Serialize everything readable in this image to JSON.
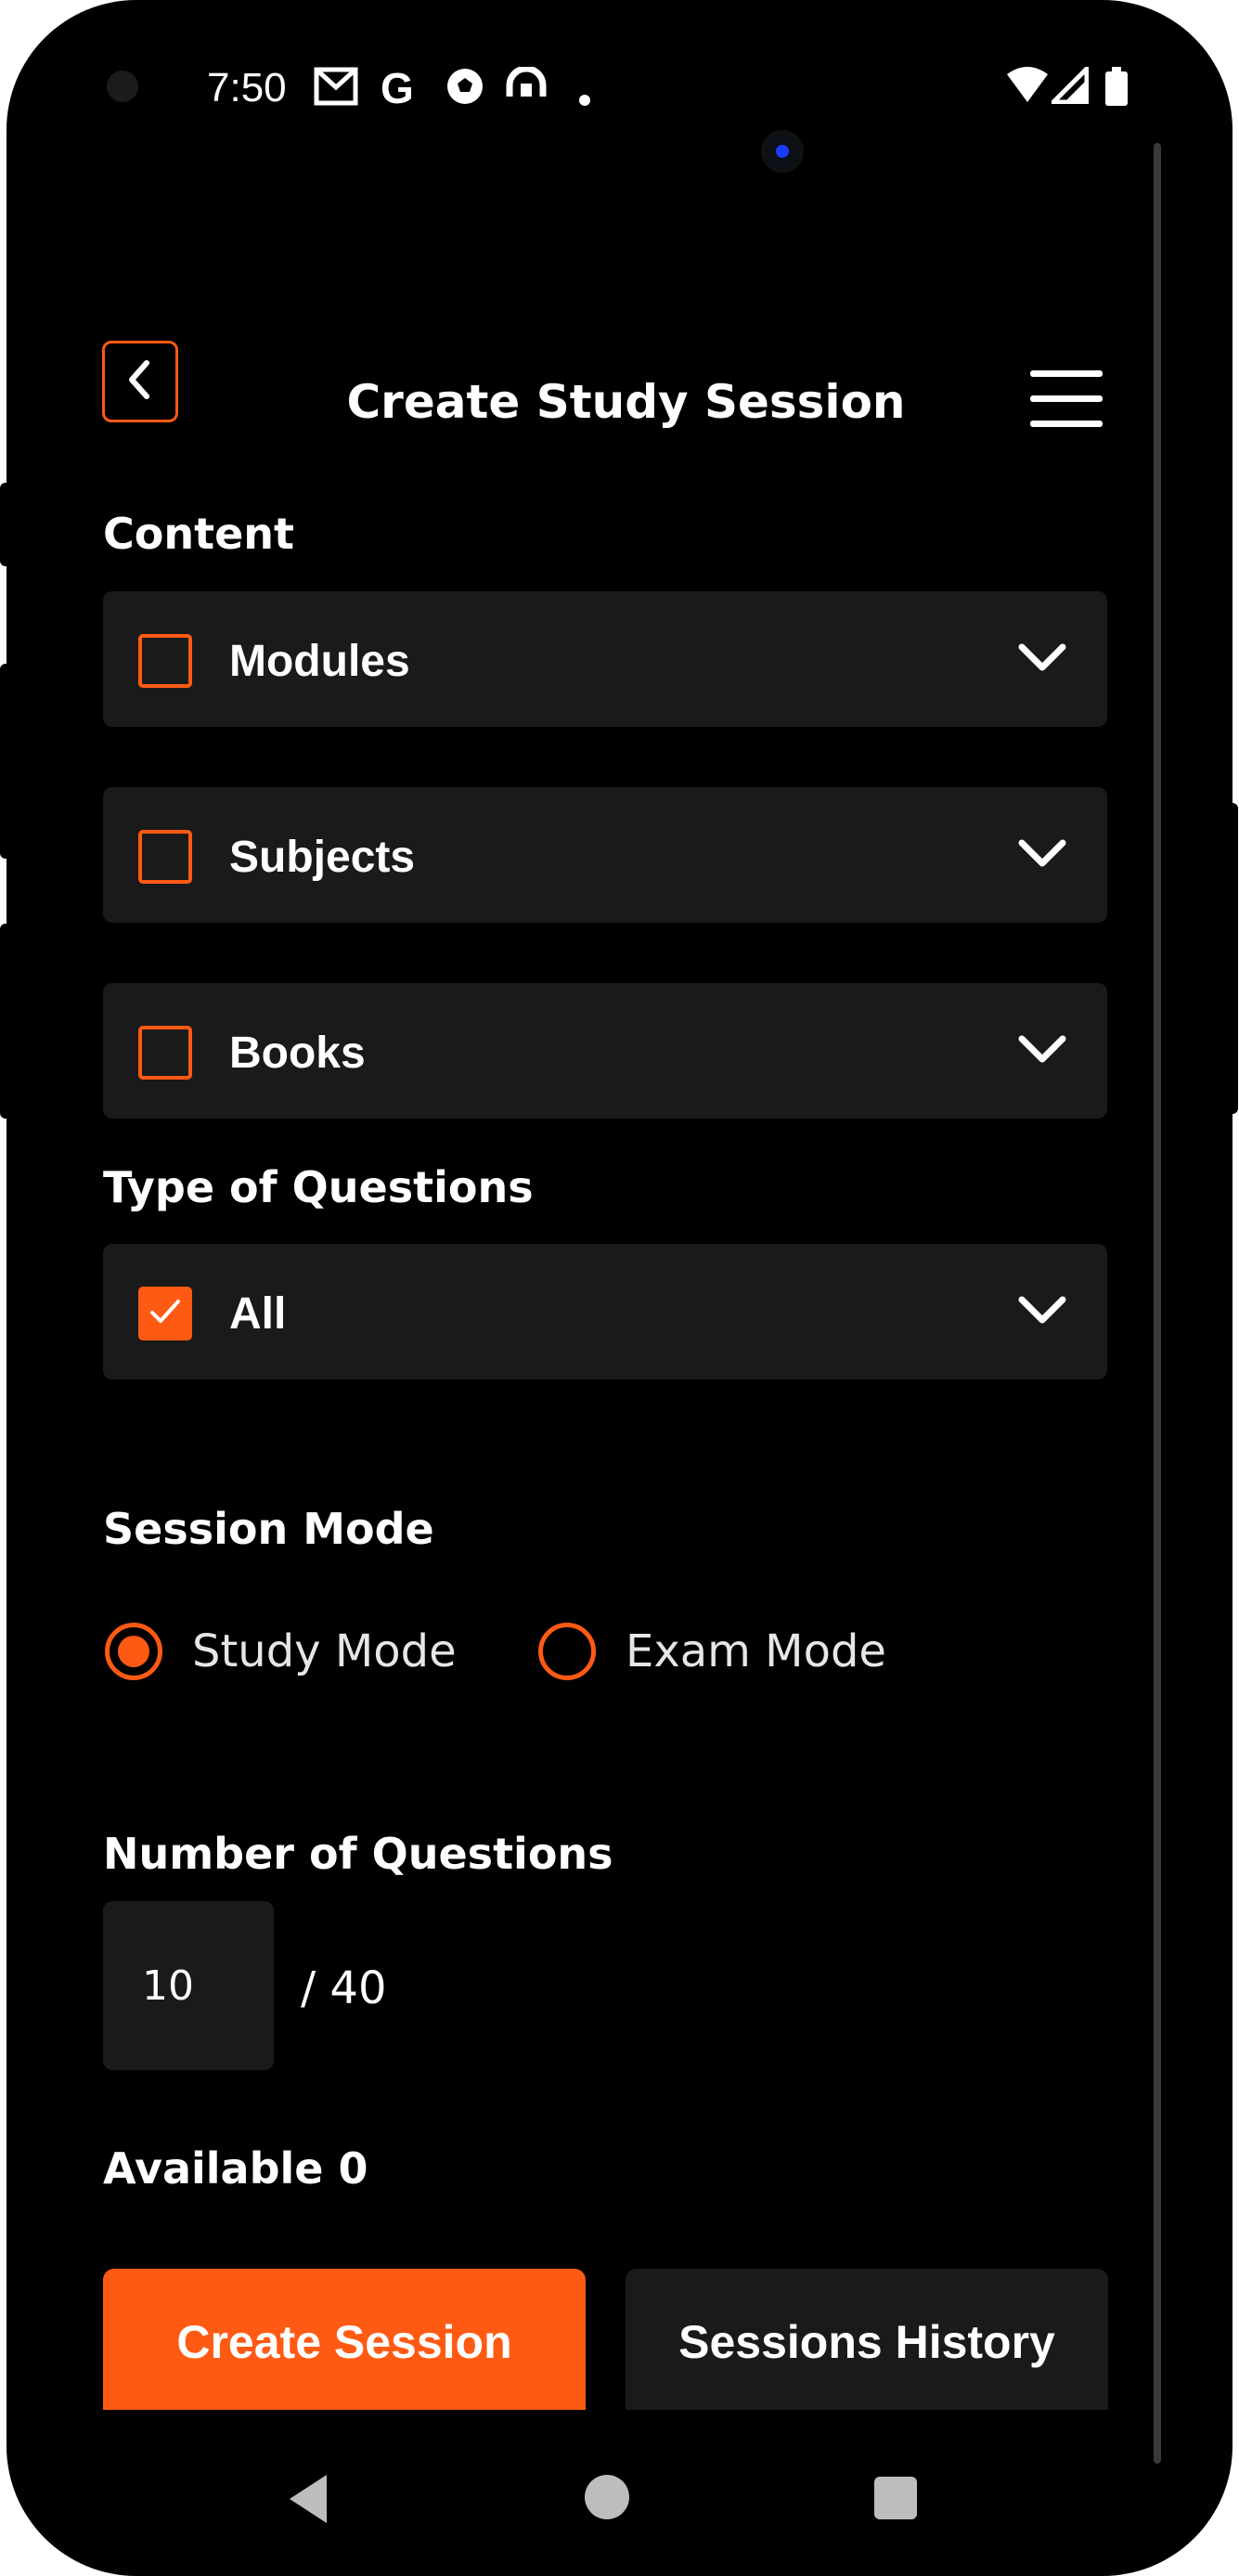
{
  "status_bar": {
    "time": "7:50",
    "icons": [
      "gmail-icon",
      "google-icon",
      "soccer-ball-icon",
      "headset-icon",
      "dot-icon",
      "wifi-icon",
      "signal-icon",
      "battery-icon"
    ],
    "google_glyph": "G"
  },
  "header": {
    "title": "Create Study Session",
    "back_icon": "chevron-left-icon",
    "menu_icon": "hamburger-menu-icon"
  },
  "content": {
    "label": "Content",
    "dropdowns": [
      {
        "label": "Modules",
        "checked": false
      },
      {
        "label": "Subjects",
        "checked": false
      },
      {
        "label": "Books",
        "checked": false
      }
    ]
  },
  "question_type": {
    "label": "Type of Questions",
    "dropdown": {
      "label": "All",
      "checked": true
    }
  },
  "session_mode": {
    "label": "Session Mode",
    "options": [
      {
        "label": "Study Mode",
        "selected": true
      },
      {
        "label": "Exam Mode",
        "selected": false
      }
    ]
  },
  "num_questions": {
    "label": "Number of Questions",
    "value": "10",
    "total": "/ 40"
  },
  "available": "Available 0",
  "buttons": {
    "create": "Create Session",
    "history": "Sessions History"
  },
  "colors": {
    "accent": "#ff5a13",
    "background": "#000000",
    "surface": "#1a1a1a"
  }
}
